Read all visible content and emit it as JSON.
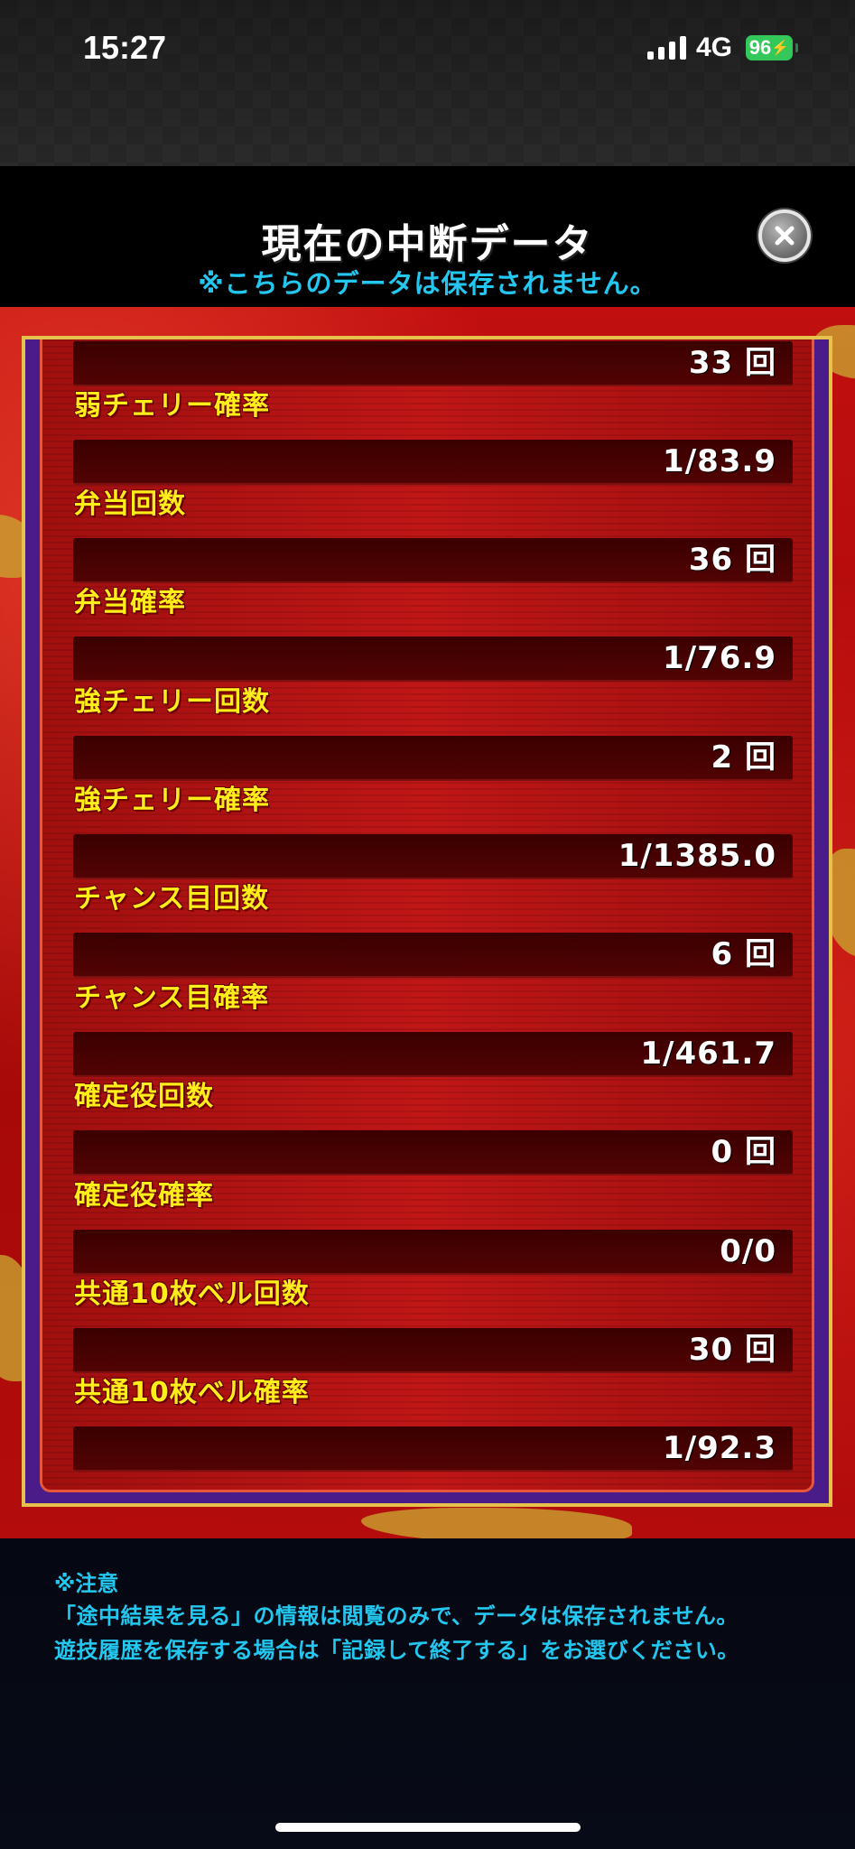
{
  "status_bar": {
    "time": "15:27",
    "network": "4G",
    "battery": "96"
  },
  "header": {
    "title": "現在の中断データ",
    "subtitle": "※こちらのデータは保存されません。"
  },
  "stats": {
    "first_value": "33 回",
    "rows": [
      {
        "label": "弱チェリー確率",
        "value": "1/83.9"
      },
      {
        "label": "弁当回数",
        "value": "36 回"
      },
      {
        "label": "弁当確率",
        "value": "1/76.9"
      },
      {
        "label": "強チェリー回数",
        "value": "2 回"
      },
      {
        "label": "強チェリー確率",
        "value": "1/1385.0"
      },
      {
        "label": "チャンス目回数",
        "value": "6 回"
      },
      {
        "label": "チャンス目確率",
        "value": "1/461.7"
      },
      {
        "label": "確定役回数",
        "value": "0 回"
      },
      {
        "label": "確定役確率",
        "value": "0/0"
      },
      {
        "label": "共通10枚ベル回数",
        "value": "30 回"
      },
      {
        "label": "共通10枚ベル確率",
        "value": "1/92.3"
      }
    ]
  },
  "notes": {
    "heading": "※注意",
    "lines": [
      "「途中結果を見る」の情報は閲覧のみで、データは保存されません。",
      "遊技履歴を保存する場合は「記録して終了する」をお選びください。"
    ]
  },
  "colors": {
    "accent_cyan": "#23c7ef",
    "label_yellow": "#ffee1a",
    "panel_red": "#c01616",
    "battery_green": "#34c759"
  }
}
